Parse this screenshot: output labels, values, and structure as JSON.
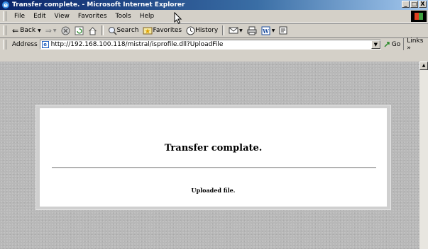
{
  "window": {
    "title": "Transfer complete. - Microsoft Internet Explorer",
    "buttons": [
      "_",
      "□",
      "X"
    ]
  },
  "menubar": {
    "items": [
      "File",
      "Edit",
      "View",
      "Favorites",
      "Tools",
      "Help"
    ]
  },
  "toolbar": {
    "back": "Back",
    "search": "Search",
    "favorites": "Favorites",
    "history": "History"
  },
  "addressbar": {
    "label": "Address",
    "url": "http://192.168.100.118/mistral/isprofile.dll?UploadFile",
    "go": "Go",
    "links": "Links »"
  },
  "page": {
    "heading": "Transfer complate.",
    "message": "Uploaded file."
  }
}
